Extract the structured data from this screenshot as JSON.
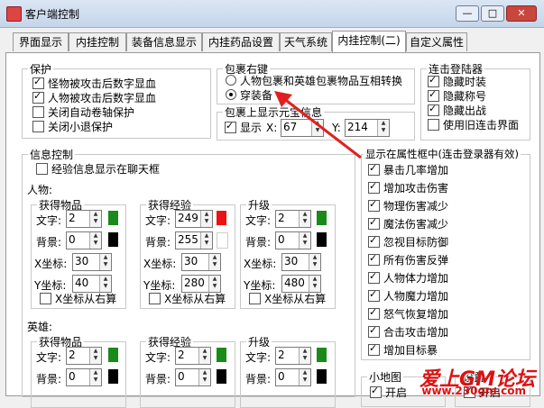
{
  "window": {
    "title": "客户端控制",
    "minimize": "—",
    "maximize": "□",
    "close": "✕"
  },
  "tabs": [
    "界面显示",
    "内挂控制",
    "装备信息显示",
    "内挂药品设置",
    "天气系统",
    "内挂控制(二)",
    "自定义属性"
  ],
  "protect": {
    "title": "保护",
    "items": [
      {
        "label": "怪物被攻击后数字显血",
        "checked": true
      },
      {
        "label": "人物被攻击后数字显血",
        "checked": true
      },
      {
        "label": "关闭自动卷轴保护",
        "checked": false
      },
      {
        "label": "关闭小退保护",
        "checked": false
      }
    ]
  },
  "bag_right": {
    "title": "包裹右键",
    "options": [
      {
        "label": "人物包裹和英雄包裹物品互相转换",
        "selected": false
      },
      {
        "label": "穿装备",
        "selected": true
      }
    ]
  },
  "bag_show": {
    "title": "包裹上显示元宝信息",
    "show_label": "显示",
    "show_checked": true,
    "x_label": "X:",
    "x_value": "67",
    "y_label": "Y:",
    "y_value": "214"
  },
  "combo": {
    "title": "连击登陆器",
    "items": [
      {
        "label": "隐藏时装",
        "checked": true
      },
      {
        "label": "隐藏称号",
        "checked": true
      },
      {
        "label": "隐藏出战",
        "checked": true
      },
      {
        "label": "使用旧连击界面",
        "checked": false
      }
    ]
  },
  "info": {
    "title": "信息控制",
    "exp_chat": "经验信息显示在聊天框",
    "person_label": "人物:",
    "hero_label": "英雄:",
    "text_label": "文字:",
    "bg_label": "背景:",
    "x_label": "X坐标:",
    "y_label": "Y坐标:",
    "x_from_right": "X坐标从右算",
    "person": [
      {
        "title": "获得物品",
        "text": "2",
        "bg": "0",
        "x": "30",
        "y": "40",
        "text_color": "#1a8a1a",
        "bg_color": "#000000"
      },
      {
        "title": "获得经验",
        "text": "249",
        "bg": "255",
        "x": "30",
        "y": "280",
        "text_color": "#ee1111",
        "bg_color": "#ffffff"
      },
      {
        "title": "升级",
        "text": "2",
        "bg": "0",
        "x": "30",
        "y": "480",
        "text_color": "#1a8a1a",
        "bg_color": "#000000"
      }
    ],
    "hero": [
      {
        "title": "获得物品",
        "text": "2",
        "bg": "0",
        "text_color": "#1a8a1a",
        "bg_color": "#000000"
      },
      {
        "title": "获得经验",
        "text": "2",
        "bg": "0",
        "text_color": "#1a8a1a",
        "bg_color": "#000000"
      },
      {
        "title": "升级",
        "text": "2",
        "bg": "0",
        "text_color": "#1a8a1a",
        "bg_color": "#000000"
      }
    ]
  },
  "attr_box": {
    "title": "显示在属性框中(连击登录器有效)",
    "items": [
      {
        "label": "暴击几率增加",
        "checked": true
      },
      {
        "label": "增加攻击伤害",
        "checked": true
      },
      {
        "label": "物理伤害减少",
        "checked": true
      },
      {
        "label": "魔法伤害减少",
        "checked": true
      },
      {
        "label": "忽视目标防御",
        "checked": true
      },
      {
        "label": "所有伤害反弹",
        "checked": true
      },
      {
        "label": "人物体力增加",
        "checked": true
      },
      {
        "label": "人物魔力增加",
        "checked": true
      },
      {
        "label": "怒气恢复增加",
        "checked": true
      },
      {
        "label": "合击攻击增加",
        "checked": true
      },
      {
        "label": "增加目标暴",
        "checked": true
      }
    ]
  },
  "bottom": {
    "left_title": "小地图",
    "left_open": "开启",
    "right_title": "设置",
    "right_open": "开启"
  },
  "watermark": {
    "main": "爱上GM论坛",
    "sub": "www.230gm.com"
  }
}
